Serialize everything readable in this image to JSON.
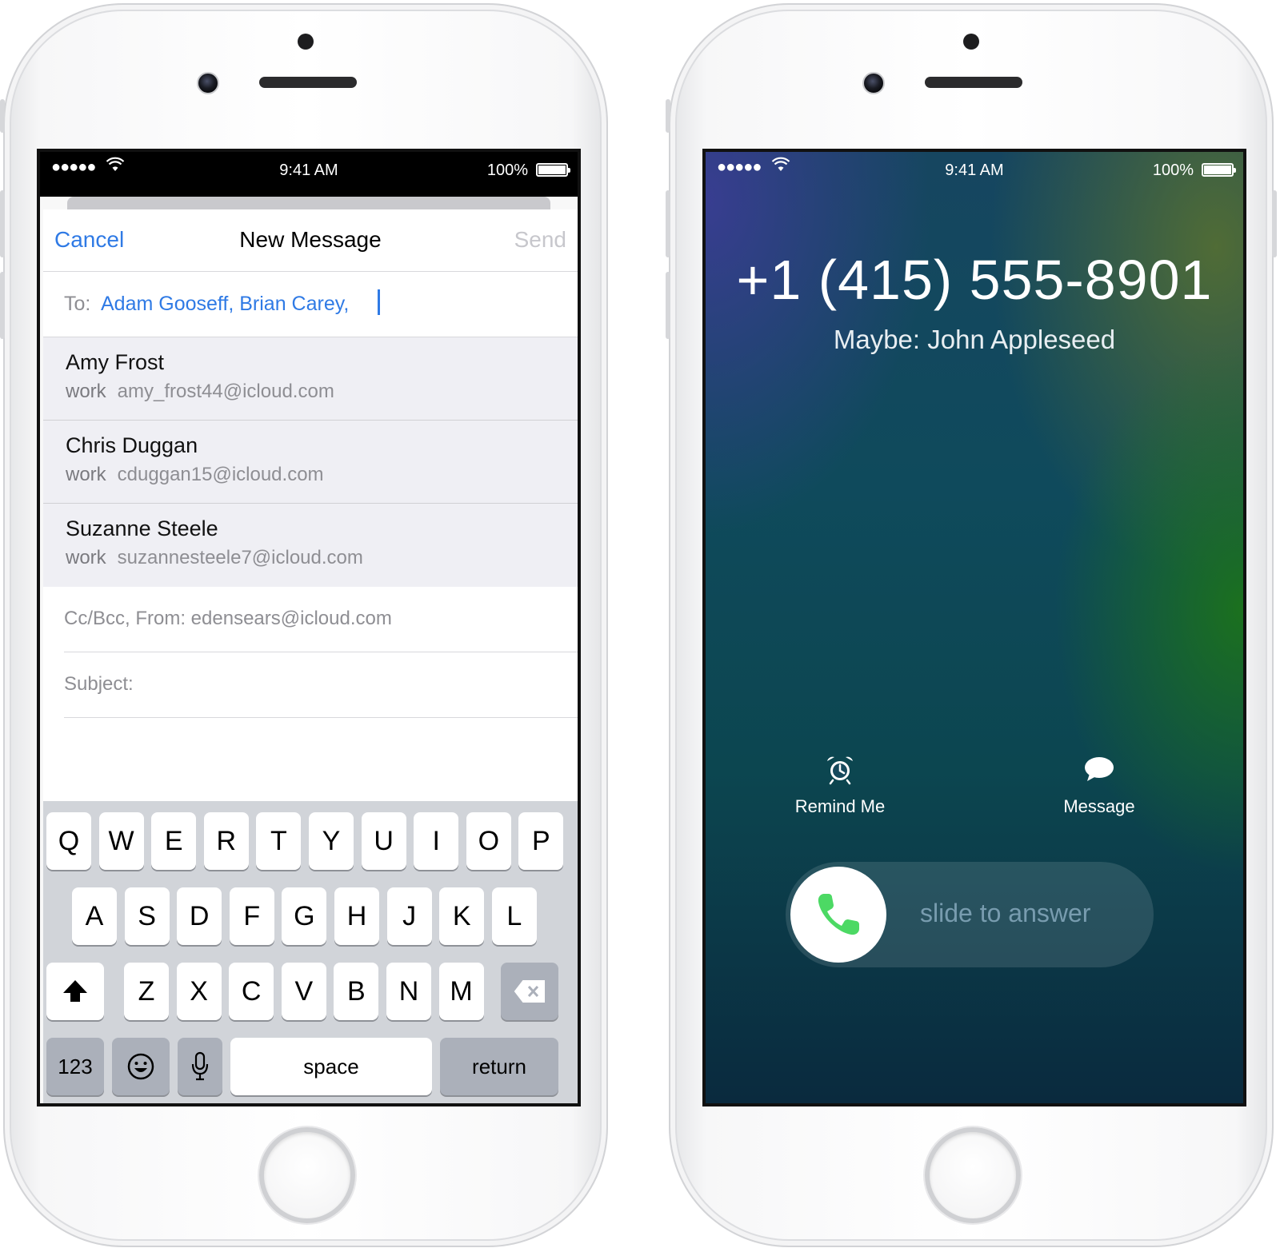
{
  "mail_phone": {
    "status": {
      "signal": "●●●●●",
      "time": "9:41 AM",
      "battery": "100%"
    },
    "nav": {
      "cancel": "Cancel",
      "title": "New Message",
      "send": "Send"
    },
    "to": {
      "label": "To:",
      "recipients": "Adam Gooseff, Brian Carey,"
    },
    "suggestions": [
      {
        "name": "Amy Frost",
        "kind": "work",
        "email": "amy_frost44@icloud.com"
      },
      {
        "name": "Chris Duggan",
        "kind": "work",
        "email": "cduggan15@icloud.com"
      },
      {
        "name": "Suzanne Steele",
        "kind": "work",
        "email": "suzannesteele7@icloud.com"
      }
    ],
    "cc_from": "Cc/Bcc, From: edensears@icloud.com",
    "subject_label": "Subject:",
    "keyboard": {
      "row1": [
        "Q",
        "W",
        "E",
        "R",
        "T",
        "Y",
        "U",
        "I",
        "O",
        "P"
      ],
      "row2": [
        "A",
        "S",
        "D",
        "F",
        "G",
        "H",
        "J",
        "K",
        "L"
      ],
      "row3": [
        "Z",
        "X",
        "C",
        "V",
        "B",
        "N",
        "M"
      ],
      "numbers": "123",
      "space": "space",
      "return": "return"
    }
  },
  "call_phone": {
    "status": {
      "signal": "●●●●●",
      "time": "9:41 AM",
      "battery": "100%"
    },
    "number": "+1 (415) 555-8901",
    "maybe": "Maybe: John Appleseed",
    "remind_label": "Remind Me",
    "message_label": "Message",
    "slide_hint": "slide to answer",
    "answer_color": "#4cd964"
  }
}
